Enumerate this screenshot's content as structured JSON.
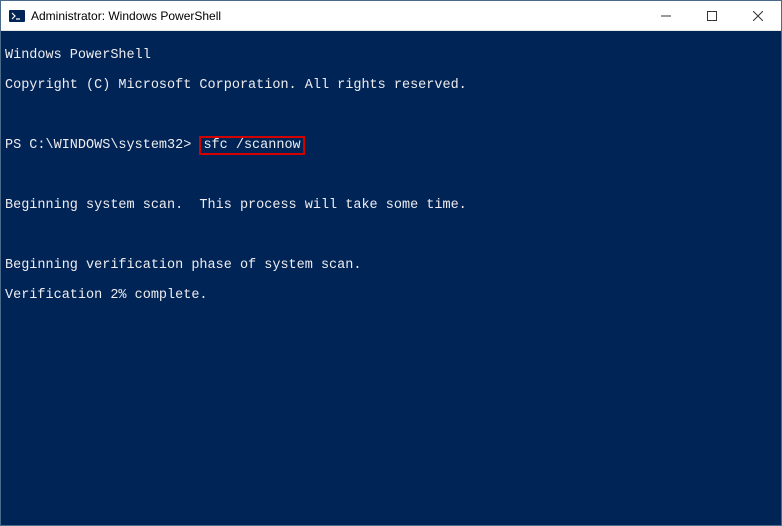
{
  "titlebar": {
    "title": "Administrator: Windows PowerShell"
  },
  "terminal": {
    "header1": "Windows PowerShell",
    "header2": "Copyright (C) Microsoft Corporation. All rights reserved.",
    "prompt": "PS C:\\WINDOWS\\system32> ",
    "command": "sfc /scannow",
    "msg1": "Beginning system scan.  This process will take some time.",
    "msg2": "Beginning verification phase of system scan.",
    "msg3": "Verification 2% complete."
  },
  "colors": {
    "terminal_bg": "#012456",
    "terminal_fg": "#eeedf0",
    "highlight_border": "#d40000"
  }
}
